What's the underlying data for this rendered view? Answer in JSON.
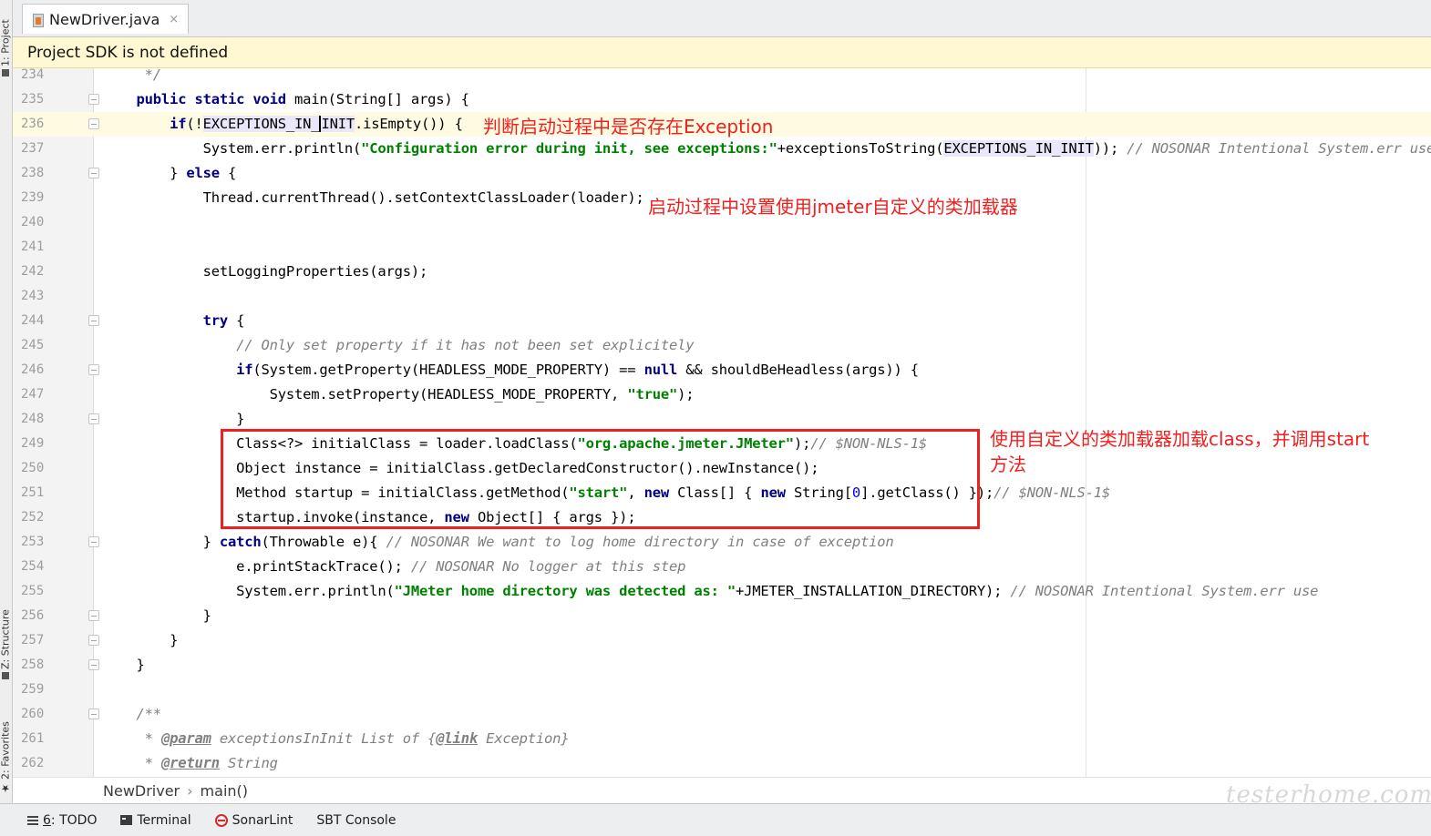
{
  "left_strip": {
    "project_tab": "1: Project",
    "structure_tab": "Z: Structure",
    "favorites_tab": "2: Favorites"
  },
  "tab": {
    "label": "NewDriver.java",
    "close": "×"
  },
  "banner": {
    "text": "Project SDK is not defined"
  },
  "lines": {
    "l234": {
      "num": "234",
      "t0": "     */"
    },
    "l235": {
      "num": "235",
      "ind": "    ",
      "k1": "public static void",
      "t1": " main(String[] args) {"
    },
    "l236": {
      "num": "236",
      "ind": "        ",
      "k1": "if",
      "t1": "(!",
      "f1a": "EXCEPTIONS_IN_",
      "f1b": "INIT",
      "t2": ".isEmpty()) {"
    },
    "l237": {
      "num": "237",
      "ind": "            ",
      "t1": "System.err.println(",
      "s1": "\"Configuration error during init, see exceptions:\"",
      "t2": "+exceptionsToString(",
      "f1": "EXCEPTIONS_IN_INIT",
      "t3": ")); ",
      "c1": "// NOSONAR Intentional System.err use"
    },
    "l238": {
      "num": "238",
      "ind": "        ",
      "t1": "} ",
      "k1": "else",
      "t2": " {"
    },
    "l239": {
      "num": "239",
      "ind": "            ",
      "t1": "Thread.currentThread().setContextClassLoader(loader);"
    },
    "l240": {
      "num": "240"
    },
    "l241": {
      "num": "241"
    },
    "l242": {
      "num": "242",
      "ind": "            ",
      "t1": "setLoggingProperties(args);"
    },
    "l243": {
      "num": "243"
    },
    "l244": {
      "num": "244",
      "ind": "            ",
      "k1": "try",
      "t1": " {"
    },
    "l245": {
      "num": "245",
      "ind": "                ",
      "c1": "// Only set property if it has not been set explicitely"
    },
    "l246": {
      "num": "246",
      "ind": "                ",
      "k1": "if",
      "t1": "(System.getProperty(HEADLESS_MODE_PROPERTY) == ",
      "k2": "null",
      "t2": " && shouldBeHeadless(args)) {"
    },
    "l247": {
      "num": "247",
      "ind": "                    ",
      "t1": "System.setProperty(HEADLESS_MODE_PROPERTY, ",
      "s1": "\"true\"",
      "t2": ");"
    },
    "l248": {
      "num": "248",
      "ind": "                ",
      "t1": "}"
    },
    "l249": {
      "num": "249",
      "ind": "                ",
      "t1": "Class<?> initialClass = loader.loadClass(",
      "s1": "\"org.apache.jmeter.JMeter\"",
      "t2": ");",
      "c1": "// $NON-NLS-1$"
    },
    "l250": {
      "num": "250",
      "ind": "                ",
      "t1": "Object instance = initialClass.getDeclaredConstructor().newInstance();"
    },
    "l251": {
      "num": "251",
      "ind": "                ",
      "t1": "Method startup = initialClass.getMethod(",
      "s1": "\"start\"",
      "t2": ", ",
      "k1": "new",
      "t3": " Class[] { ",
      "k2": "new",
      "t4": " String[",
      "n1": "0",
      "t5": "].getClass() });",
      "c1": "// $NON-NLS-1$"
    },
    "l252": {
      "num": "252",
      "ind": "                ",
      "t1": "startup.invoke(instance, ",
      "k1": "new",
      "t2": " Object[] { args });"
    },
    "l253": {
      "num": "253",
      "ind": "            ",
      "t1": "} ",
      "k1": "catch",
      "t2": "(Throwable e){ ",
      "c1": "// NOSONAR We want to log home directory in case of exception"
    },
    "l254": {
      "num": "254",
      "ind": "                ",
      "t1": "e.printStackTrace(); ",
      "c1": "// NOSONAR No logger at this step"
    },
    "l255": {
      "num": "255",
      "ind": "                ",
      "t1": "System.err.println(",
      "s1": "\"JMeter home directory was detected as: \"",
      "t2": "+JMETER_INSTALLATION_DIRECTORY); ",
      "c1": "// NOSONAR Intentional System.err use"
    },
    "l256": {
      "num": "256",
      "ind": "            ",
      "t1": "}"
    },
    "l257": {
      "num": "257",
      "ind": "        ",
      "t1": "}"
    },
    "l258": {
      "num": "258",
      "ind": "    ",
      "t1": "}"
    },
    "l259": {
      "num": "259"
    },
    "l260": {
      "num": "260",
      "ind": "    ",
      "c1": "/**"
    },
    "l261": {
      "num": "261",
      "ind": "     ",
      "c1": "* ",
      "c2": "@param",
      "c3": " exceptionsInInit List of {",
      "c4": "@link",
      "c5": " Exception}"
    },
    "l262": {
      "num": "262",
      "ind": "     ",
      "c1": "* ",
      "c2": "@return",
      "c3": " String"
    }
  },
  "annotations": {
    "a1": "判断启动过程中是否存在Exception",
    "a2": "启动过程中设置使用jmeter自定义的类加载器",
    "a3_line1": "使用自定义的类加载器加载class，并调用start",
    "a3_line2": "方法"
  },
  "breadcrumb": {
    "class_name": "NewDriver",
    "sep": "›",
    "method": "main()"
  },
  "bottom_bar": {
    "todo_num": "6",
    "todo_label": ": TODO",
    "terminal": "Terminal",
    "sonarlint": "SonarLint",
    "sbt": "SBT Console"
  },
  "watermark": "testerhome.com",
  "colors": {
    "keyword": "#000080",
    "string": "#008000",
    "comment": "#808080",
    "annotation_red": "#f21f1f",
    "banner_bg": "#fff8d2",
    "current_line": "#fffae2"
  }
}
